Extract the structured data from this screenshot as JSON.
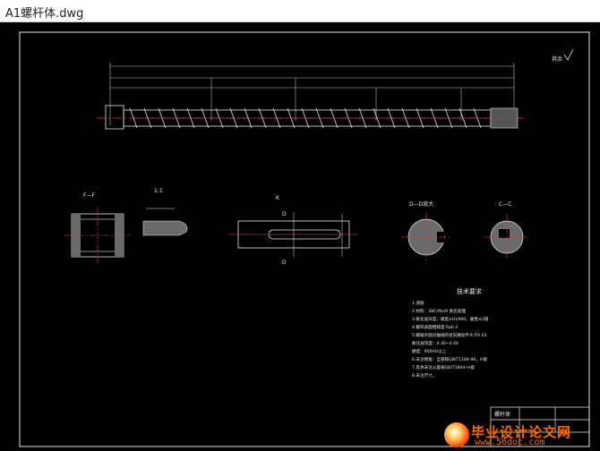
{
  "window": {
    "title": "A1螺杆体.dwg"
  },
  "drawing": {
    "roughness_symbol": "其余",
    "section_labels": {
      "ff": "F—F",
      "detail": "1:1",
      "k": "K",
      "dd": "D—D放大",
      "cc": "C—C",
      "d_mark": "D"
    },
    "tech_requirements": {
      "title": "技术要求",
      "lines": [
        "1.调质",
        "2.材料：38CrMoAl 氮化处理",
        "3.氮化层深度，硬度≥HV900，脆性≤2级",
        "4.螺杆表面粗糙度 Ra0.4",
        "5.螺棱外圆对轴线的径向跳动不大于0.03",
        "氮化层深度：0.30~0.40",
        "硬度：900HV以上",
        "6.未注倒角：全部按GB/T1184-96，H级",
        "7.其余未注公差按GB/T1804-m级",
        "8.未注尺寸。"
      ]
    },
    "title_block": {
      "name": "螺杆体"
    }
  },
  "watermark": {
    "text": "毕业设计论文网",
    "url": "www.56doc.com"
  }
}
